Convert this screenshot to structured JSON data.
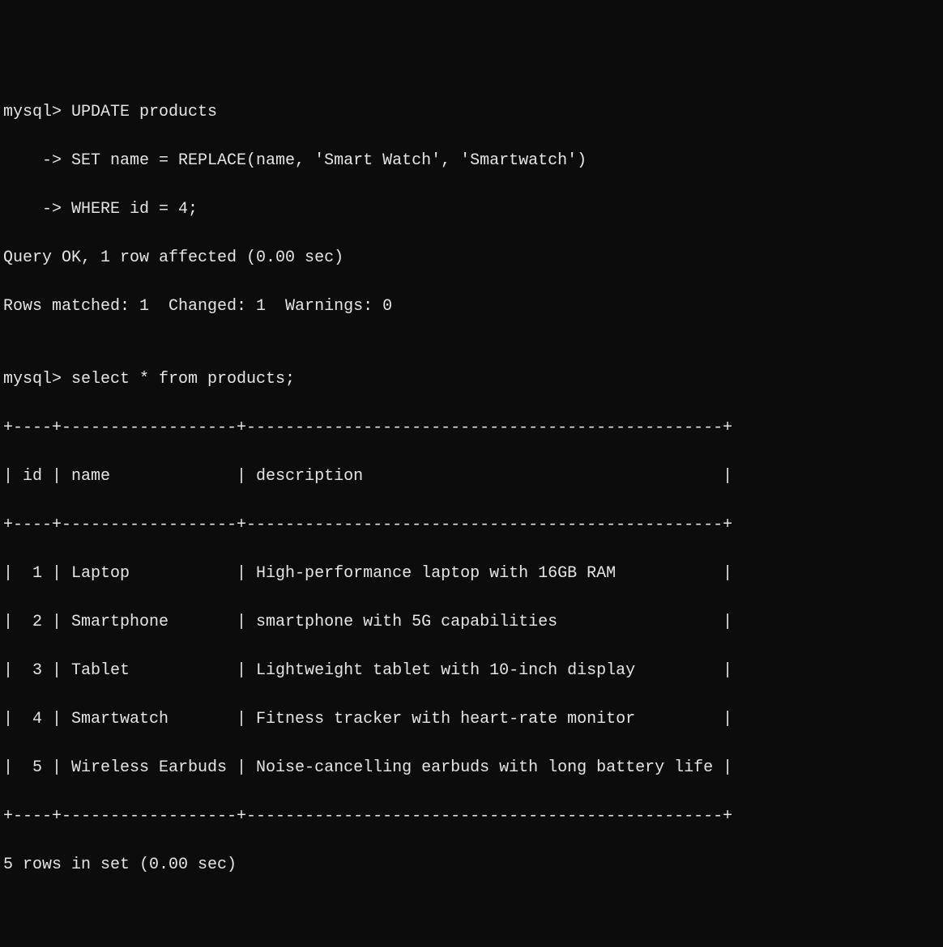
{
  "prompt1": "mysql> ",
  "update_line1": "UPDATE products",
  "cont_prompt": "    -> ",
  "update_line2": "SET name = REPLACE(name, 'Smart Watch', 'Smartwatch')",
  "update_line3": "WHERE id = 4;",
  "query_ok": "Query OK, 1 row affected (0.00 sec)",
  "rows_matched": "Rows matched: 1  Changed: 1  Warnings: 0",
  "blank": "",
  "prompt2": "mysql> ",
  "select_query": "select * from products;",
  "table_border": "+----+------------------+-------------------------------------------------+",
  "table_header": "| id | name             | description                                     |",
  "row1": "|  1 | Laptop           | High-performance laptop with 16GB RAM           |",
  "row2": "|  2 | Smartphone       | smartphone with 5G capabilities                 |",
  "row3": "|  3 | Tablet           | Lightweight tablet with 10-inch display         |",
  "row4": "|  4 | Smartwatch       | Fitness tracker with heart-rate monitor         |",
  "row5": "|  5 | Wireless Earbuds | Noise-cancelling earbuds with long battery life |",
  "rows_in_set": "5 rows in set (0.00 sec)",
  "chart_data": {
    "type": "table",
    "columns": [
      "id",
      "name",
      "description"
    ],
    "rows": [
      [
        1,
        "Laptop",
        "High-performance laptop with 16GB RAM"
      ],
      [
        2,
        "Smartphone",
        "smartphone with 5G capabilities"
      ],
      [
        3,
        "Tablet",
        "Lightweight tablet with 10-inch display"
      ],
      [
        4,
        "Smartwatch",
        "Fitness tracker with heart-rate monitor"
      ],
      [
        5,
        "Wireless Earbuds",
        "Noise-cancelling earbuds with long battery life"
      ]
    ]
  }
}
